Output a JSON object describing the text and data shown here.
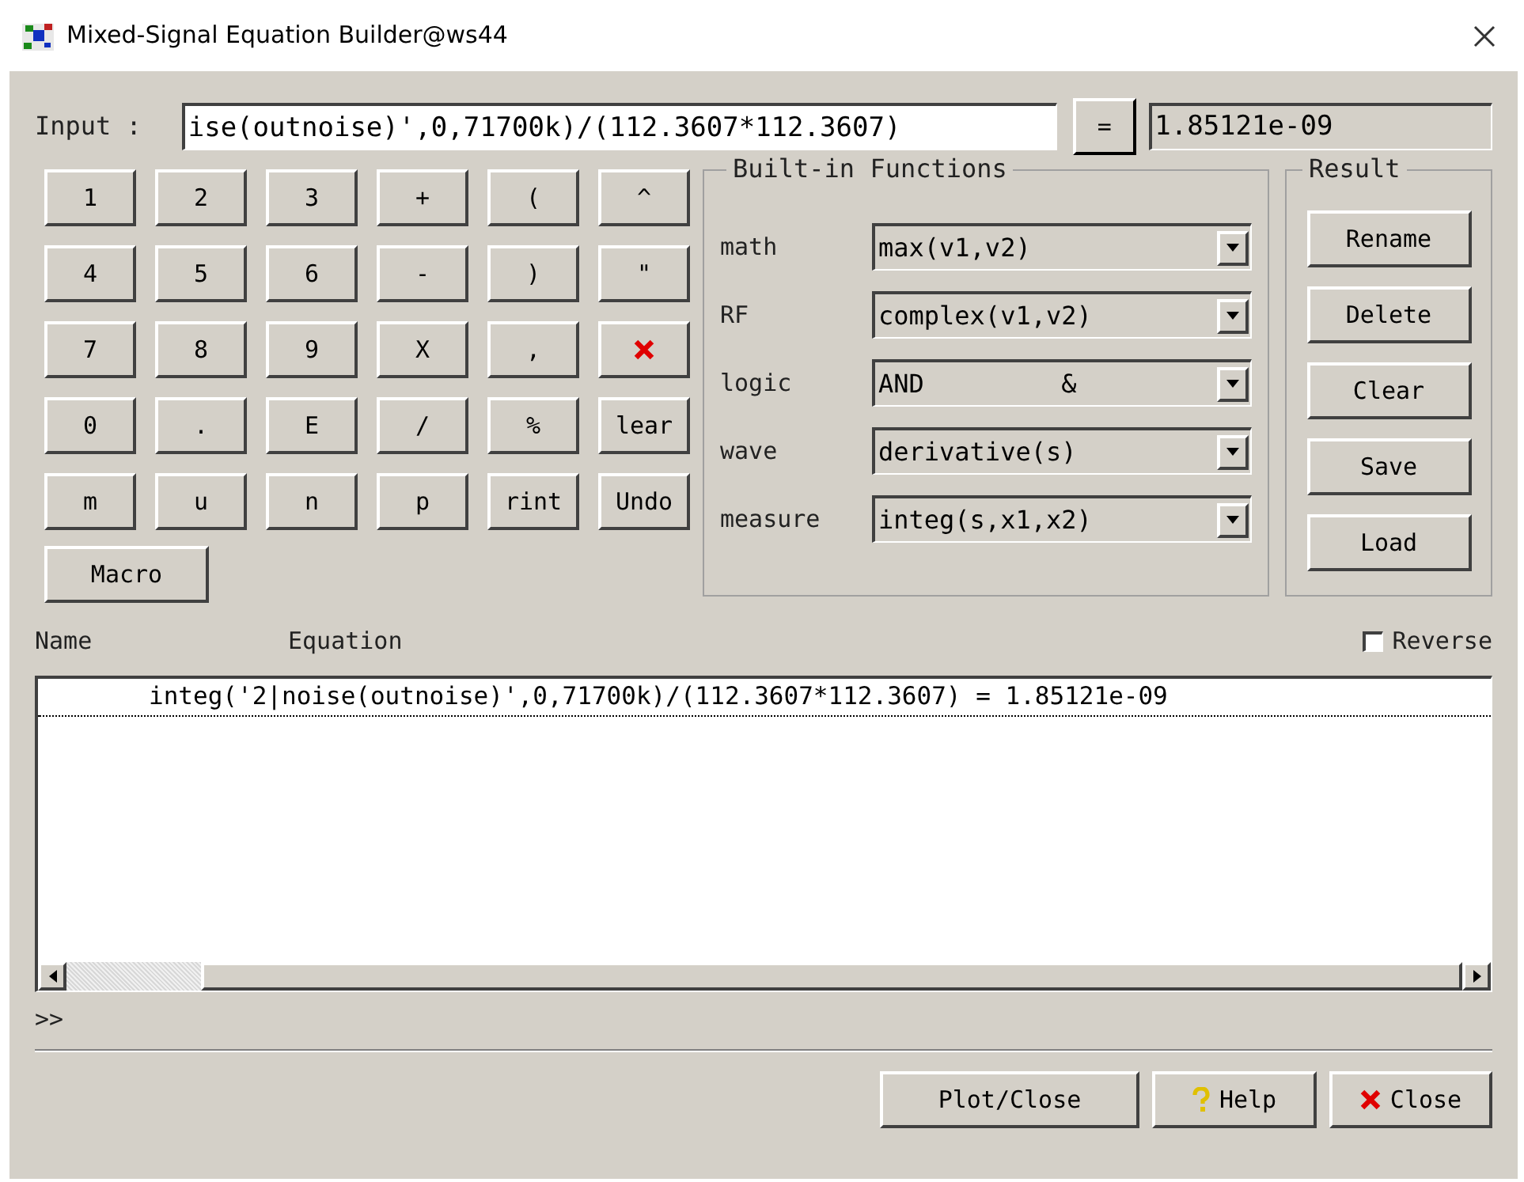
{
  "window": {
    "title": "Mixed-Signal Equation Builder@ws44"
  },
  "input": {
    "label": "Input :",
    "value": "ise(outnoise)',0,71700k)/(112.3607*112.3607)",
    "equals": "=",
    "result": "1.85121e-09"
  },
  "keypad": [
    {
      "kind": "text",
      "label": "1"
    },
    {
      "kind": "text",
      "label": "2"
    },
    {
      "kind": "text",
      "label": "3"
    },
    {
      "kind": "text",
      "label": "+"
    },
    {
      "kind": "text",
      "label": "("
    },
    {
      "kind": "text",
      "label": "^"
    },
    {
      "kind": "text",
      "label": "4"
    },
    {
      "kind": "text",
      "label": "5"
    },
    {
      "kind": "text",
      "label": "6"
    },
    {
      "kind": "text",
      "label": "-"
    },
    {
      "kind": "text",
      "label": ")"
    },
    {
      "kind": "text",
      "label": "\""
    },
    {
      "kind": "text",
      "label": "7"
    },
    {
      "kind": "text",
      "label": "8"
    },
    {
      "kind": "text",
      "label": "9"
    },
    {
      "kind": "text",
      "label": "X"
    },
    {
      "kind": "text",
      "label": ","
    },
    {
      "kind": "icon"
    },
    {
      "kind": "text",
      "label": "0"
    },
    {
      "kind": "text",
      "label": "."
    },
    {
      "kind": "text",
      "label": "E"
    },
    {
      "kind": "text",
      "label": "/"
    },
    {
      "kind": "text",
      "label": "%"
    },
    {
      "kind": "text",
      "label": "lear"
    },
    {
      "kind": "text",
      "label": "m"
    },
    {
      "kind": "text",
      "label": "u"
    },
    {
      "kind": "text",
      "label": "n"
    },
    {
      "kind": "text",
      "label": "p"
    },
    {
      "kind": "text",
      "label": "rint"
    },
    {
      "kind": "text",
      "label": "Undo"
    }
  ],
  "macro_button": "Macro",
  "builtin_functions": {
    "title": "Built-in Functions",
    "rows": [
      {
        "label": "math",
        "value": "max(v1,v2)"
      },
      {
        "label": "RF",
        "value": "complex(v1,v2)"
      },
      {
        "label": "logic",
        "value": "AND         &"
      },
      {
        "label": "wave",
        "value": "derivative(s)"
      },
      {
        "label": "measure",
        "value": "integ(s,x1,x2)"
      }
    ]
  },
  "result": {
    "title": "Result",
    "buttons": [
      "Rename",
      "Delete",
      "Clear",
      "Save",
      "Load"
    ]
  },
  "list": {
    "columns": [
      "Name",
      "Equation"
    ],
    "reverse": {
      "label": "Reverse",
      "checked": false
    },
    "rows": [
      {
        "name": "",
        "equation": "integ('2|noise(outnoise)',0,71700k)/(112.3607*112.3607) = 1.85121e-09"
      }
    ]
  },
  "prompt": ">>",
  "footer": {
    "buttons": [
      {
        "kind": "plain",
        "label": "Plot/Close"
      },
      {
        "kind": "help",
        "label": "Help"
      },
      {
        "kind": "close",
        "label": "Close"
      }
    ]
  }
}
